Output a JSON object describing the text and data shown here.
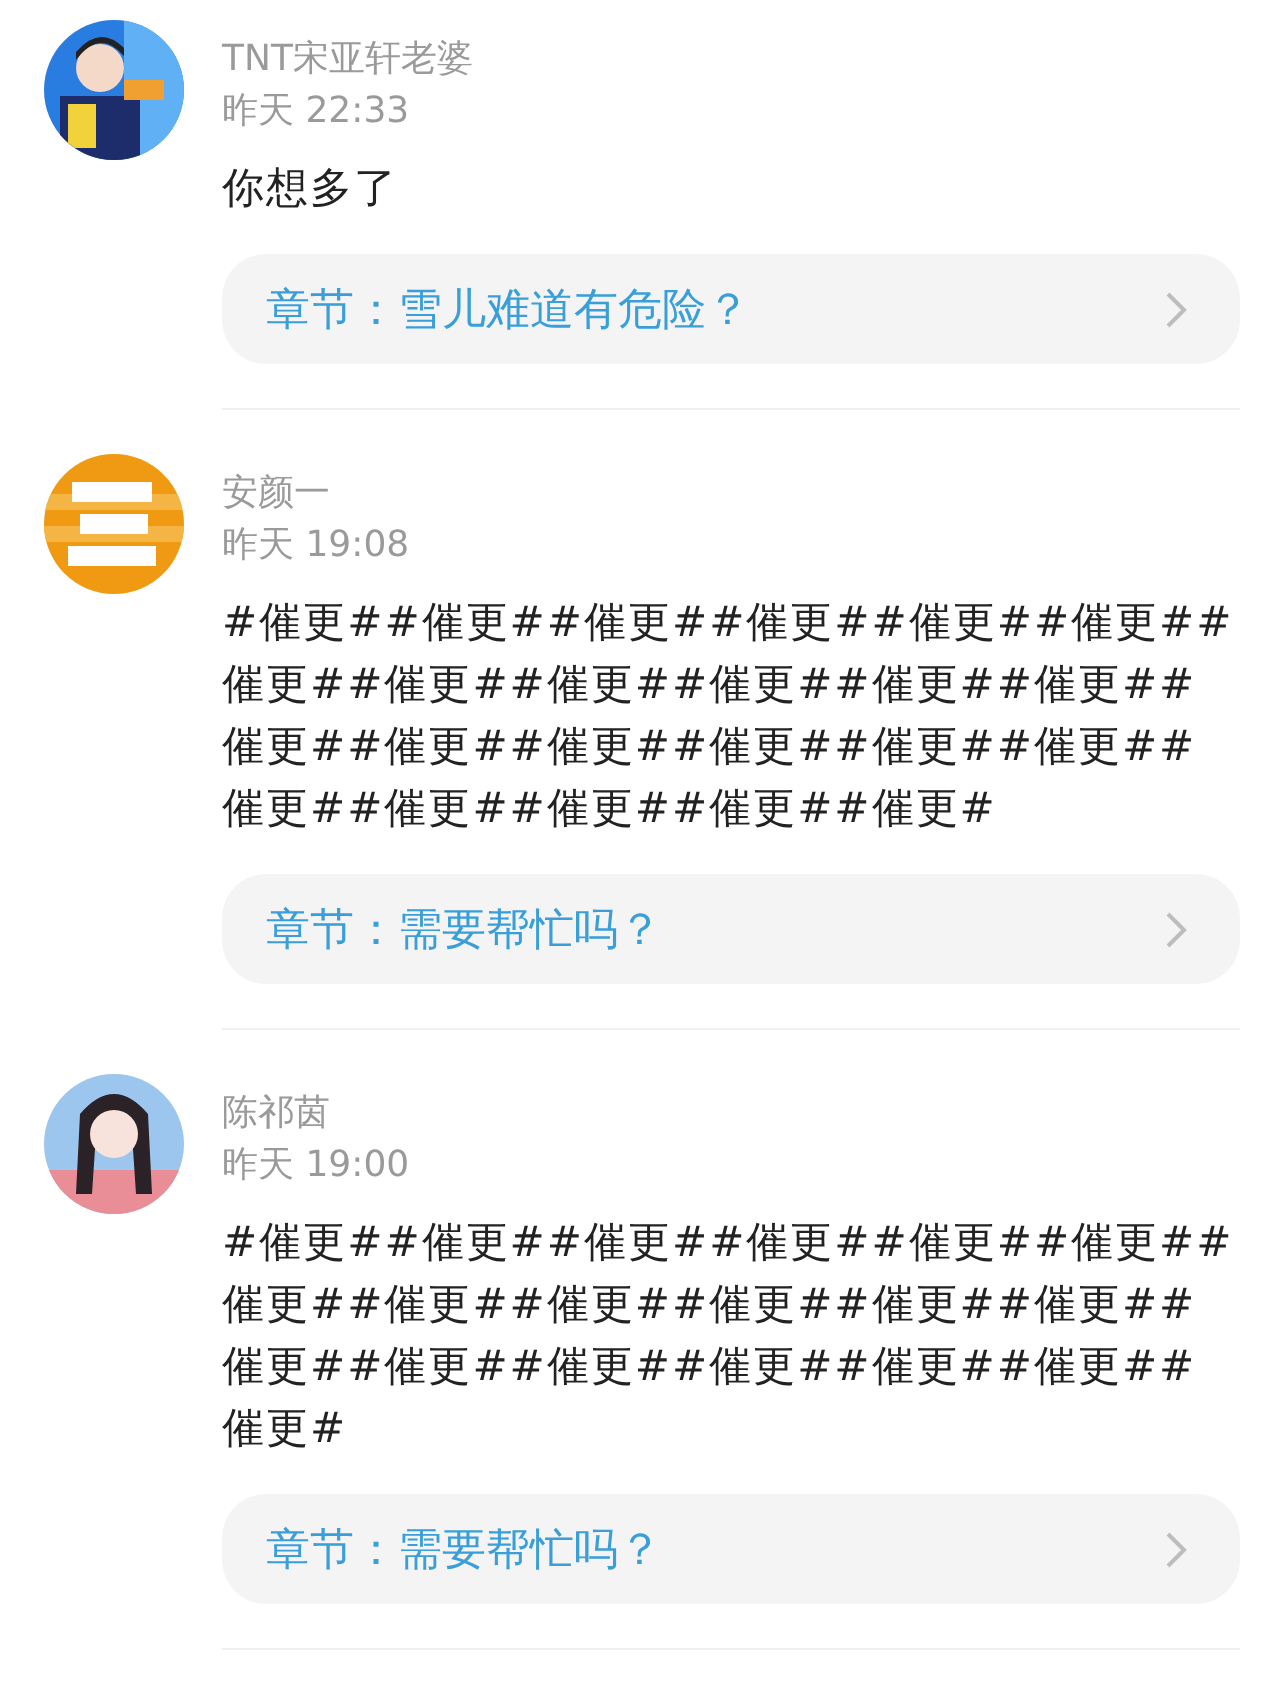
{
  "comments": [
    {
      "name": "TNT宋亚轩老婆",
      "time": "昨天 22:33",
      "text": "你想多了",
      "chapter": "章节：雪儿难道有危险？"
    },
    {
      "name": "安颜一",
      "time": "昨天 19:08",
      "text": "#催更##催更##催更##催更##催更##催更##催更##催更##催更##催更##催更##催更##催更##催更##催更##催更##催更##催更##催更##催更##催更##催更##催更#",
      "chapter": "章节：需要帮忙吗？"
    },
    {
      "name": "陈祁茵",
      "time": "昨天 19:00",
      "text": "#催更##催更##催更##催更##催更##催更##催更##催更##催更##催更##催更##催更##催更##催更##催更##催更##催更##催更##催更#",
      "chapter": "章节：需要帮忙吗？"
    }
  ]
}
